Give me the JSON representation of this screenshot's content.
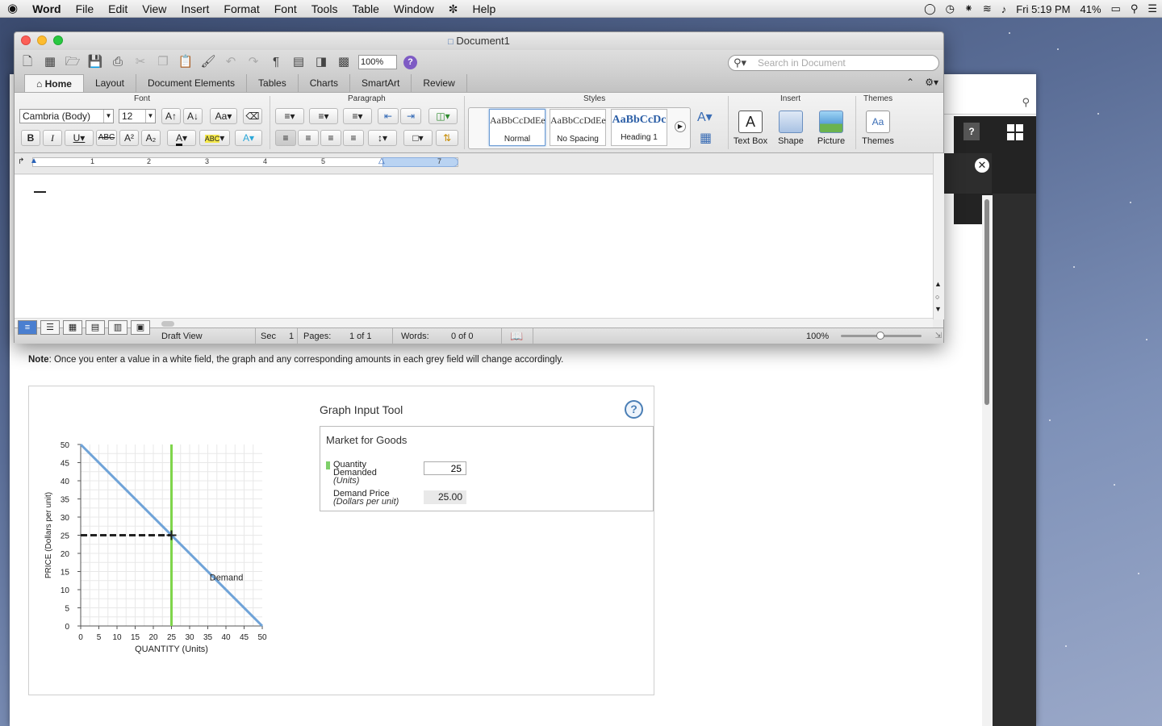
{
  "menubar": {
    "apple": "",
    "app": "Word",
    "items": [
      "File",
      "Edit",
      "View",
      "Insert",
      "Format",
      "Font",
      "Tools",
      "Table",
      "Window",
      "Help"
    ],
    "clock": "Fri 5:19 PM",
    "battery": "41%"
  },
  "word": {
    "title": "Document1",
    "zoom": "100%",
    "search_placeholder": "Search in Document",
    "tabs": [
      "Home",
      "Layout",
      "Document Elements",
      "Tables",
      "Charts",
      "SmartArt",
      "Review"
    ],
    "groups": {
      "font": "Font",
      "paragraph": "Paragraph",
      "styles": "Styles",
      "insert": "Insert",
      "themes": "Themes"
    },
    "font_name": "Cambria (Body)",
    "font_size": "12",
    "styles": [
      {
        "preview": "AaBbCcDdEe",
        "name": "Normal"
      },
      {
        "preview": "AaBbCcDdEe",
        "name": "No Spacing"
      },
      {
        "preview": "AaBbCcDc",
        "name": "Heading 1"
      }
    ],
    "insert_items": [
      "Text Box",
      "Shape",
      "Picture"
    ],
    "themes_label": "Themes",
    "ruler_numbers": [
      "1",
      "2",
      "3",
      "4",
      "5",
      "7"
    ],
    "status": {
      "view": "Draft View",
      "sec_label": "Sec",
      "sec": "1",
      "pages_label": "Pages:",
      "pages": "1 of 1",
      "words_label": "Words:",
      "words": "0 of 0",
      "zoom": "100%"
    }
  },
  "note": {
    "bold": "Note",
    "text": ": Once you enter a value in a white field, the graph and any corresponding amounts in each grey field will change accordingly."
  },
  "tool": {
    "title": "Graph Input Tool",
    "help": "?",
    "market": "Market for Goods",
    "qd_label1": "Quantity",
    "qd_label2": "Demanded",
    "qd_unit": "(Units)",
    "qd_value": "25",
    "dp_label": "Demand Price",
    "dp_unit": "(Dollars per unit)",
    "dp_value": "25.00"
  },
  "chart_data": {
    "type": "line",
    "xlabel": "QUANTITY (Units)",
    "ylabel": "PRICE (Dollars per unit)",
    "xlim": [
      0,
      50
    ],
    "ylim": [
      0,
      50
    ],
    "xticks": [
      0,
      5,
      10,
      15,
      20,
      25,
      30,
      35,
      40,
      45,
      50
    ],
    "yticks": [
      0,
      5,
      10,
      15,
      20,
      25,
      30,
      35,
      40,
      45,
      50
    ],
    "grid": true,
    "series": [
      {
        "name": "Demand",
        "x": [
          0,
          50
        ],
        "y": [
          50,
          0
        ],
        "color": "#6fa3d8"
      }
    ],
    "vertical_line": {
      "x": 25,
      "color": "#7fd54b"
    },
    "dashed_line": {
      "from_x": 0,
      "to_x": 25,
      "y": 25,
      "color": "#222222"
    },
    "point": {
      "x": 25,
      "y": 25
    }
  }
}
